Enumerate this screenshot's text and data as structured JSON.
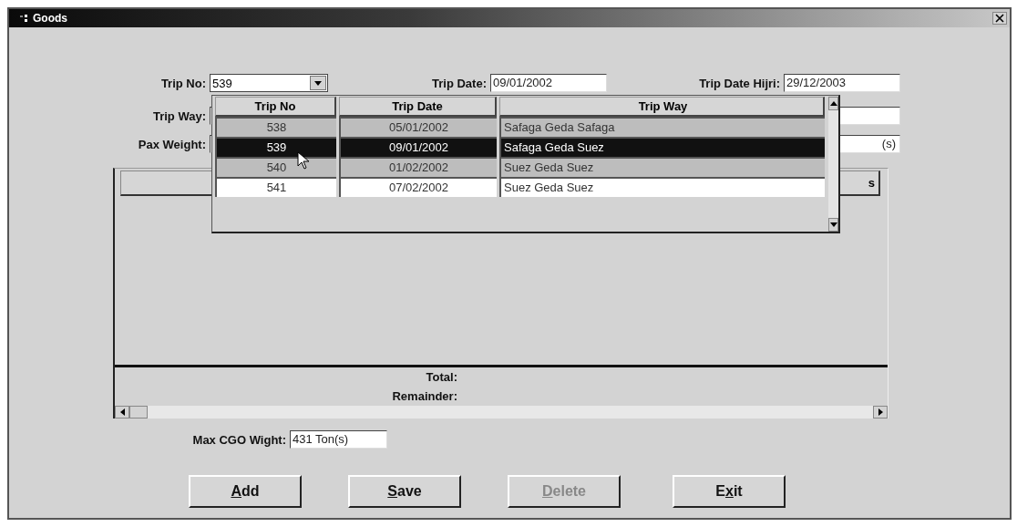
{
  "window": {
    "title": "Goods"
  },
  "trip_no": {
    "label": "Trip No:",
    "value": "539"
  },
  "trip_date": {
    "label": "Trip Date:",
    "value": "09/01/2002"
  },
  "trip_date_hijri": {
    "label": "Trip Date Hijri:",
    "value": "29/12/2003"
  },
  "trip_way": {
    "label": "Trip Way:"
  },
  "pax_weight": {
    "label": "Pax Weight:",
    "value": "(s)"
  },
  "dropdown": {
    "columns": [
      "Trip No",
      "Trip Date",
      "Trip Way"
    ],
    "rows": [
      {
        "cells": [
          "538",
          "05/01/2002",
          "Safaga Geda Safaga"
        ],
        "selected": false,
        "current": false
      },
      {
        "cells": [
          "539",
          "09/01/2002",
          "Safaga Geda Suez"
        ],
        "selected": true,
        "current": false
      },
      {
        "cells": [
          "540",
          "01/02/2002",
          "Suez Geda Suez"
        ],
        "selected": false,
        "current": false
      },
      {
        "cells": [
          "541",
          "07/02/2002",
          "Suez Geda Suez"
        ],
        "selected": false,
        "current": true
      }
    ]
  },
  "grid": {
    "header_text": "s",
    "total_label": "Total:",
    "remainder_label": "Remainder:"
  },
  "max_cgo": {
    "label": "Max CGO Wight:",
    "value": "431 Ton(s)"
  },
  "buttons": [
    {
      "label_parts": [
        {
          "text": "A",
          "underlined": true
        },
        {
          "text": "dd",
          "underlined": false
        }
      ],
      "disabled": false
    },
    {
      "label_parts": [
        {
          "text": "S",
          "underlined": true
        },
        {
          "text": "ave",
          "underlined": false
        }
      ],
      "disabled": false
    },
    {
      "label_parts": [
        {
          "text": "D",
          "underlined": true
        },
        {
          "text": "elete",
          "underlined": false
        }
      ],
      "disabled": true
    },
    {
      "label_parts": [
        {
          "text": "E",
          "underlined": false
        },
        {
          "text": "x",
          "underlined": true
        },
        {
          "text": "it",
          "underlined": false
        }
      ],
      "disabled": false
    }
  ]
}
